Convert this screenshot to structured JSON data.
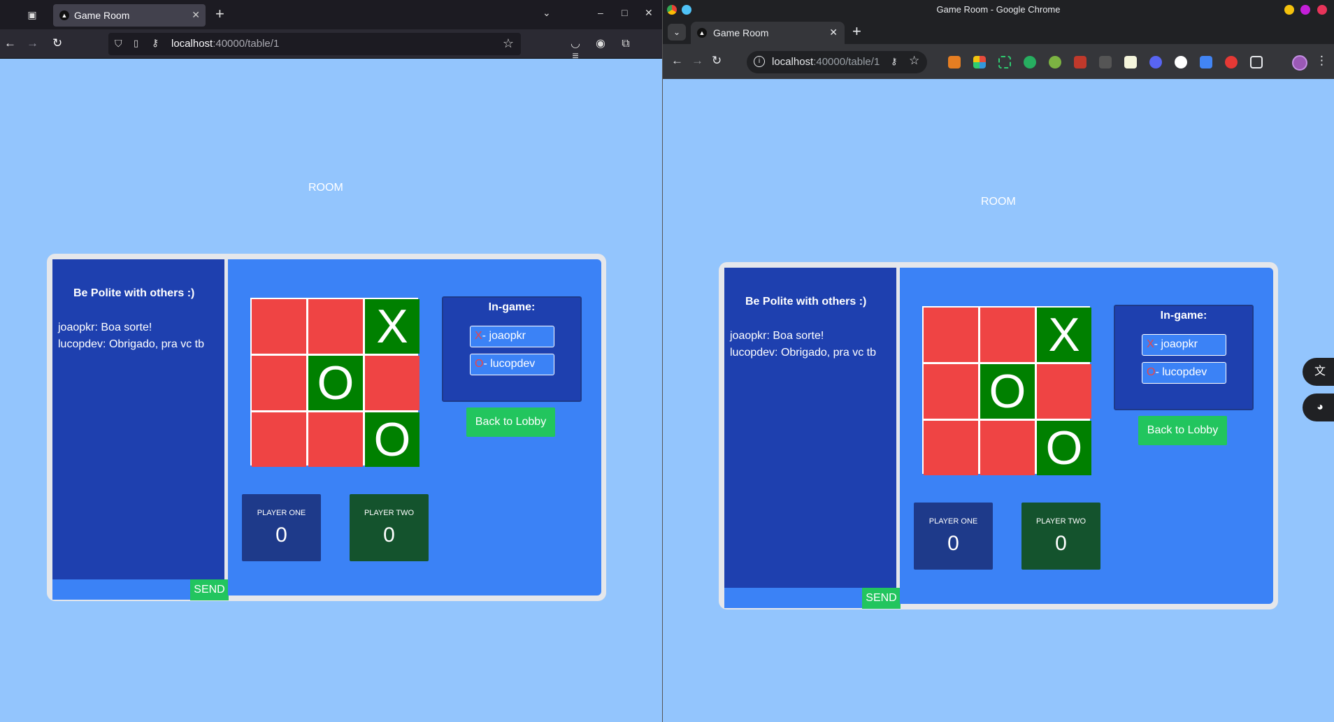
{
  "left_browser": {
    "tab_title": "Game Room",
    "url_host": "localhost",
    "url_path": ":40000/table/1"
  },
  "right_browser": {
    "window_title": "Game Room - Google Chrome",
    "tab_title": "Game Room",
    "url_host": "localhost",
    "url_path": ":40000/table/1"
  },
  "page": {
    "room_title": "ROOM",
    "chat": {
      "title": "Be Polite with others :)",
      "messages": [
        "joaopkr: Boa sorte!",
        "lucopdev: Obrigado, pra vc tb"
      ],
      "send_label": "SEND"
    },
    "board": [
      "",
      "",
      "X",
      "",
      "O",
      "",
      "",
      "",
      "O"
    ],
    "ingame": {
      "title": "In-game:",
      "player_x": {
        "mark": "X",
        "name": "- joaopkr"
      },
      "player_o": {
        "mark": "O",
        "name": "- lucopdev"
      }
    },
    "back_label": "Back to Lobby",
    "scores": {
      "player_one": {
        "label": "PLAYER ONE",
        "value": "0"
      },
      "player_two": {
        "label": "PLAYER TWO",
        "value": "0"
      }
    }
  },
  "colors": {
    "page_bg": "#93c5fd",
    "panel_bg": "#3b82f6",
    "chat_bg": "#1e40af",
    "cell_empty": "#ef4444",
    "cell_filled": "#008000",
    "button_green": "#22c55e"
  }
}
